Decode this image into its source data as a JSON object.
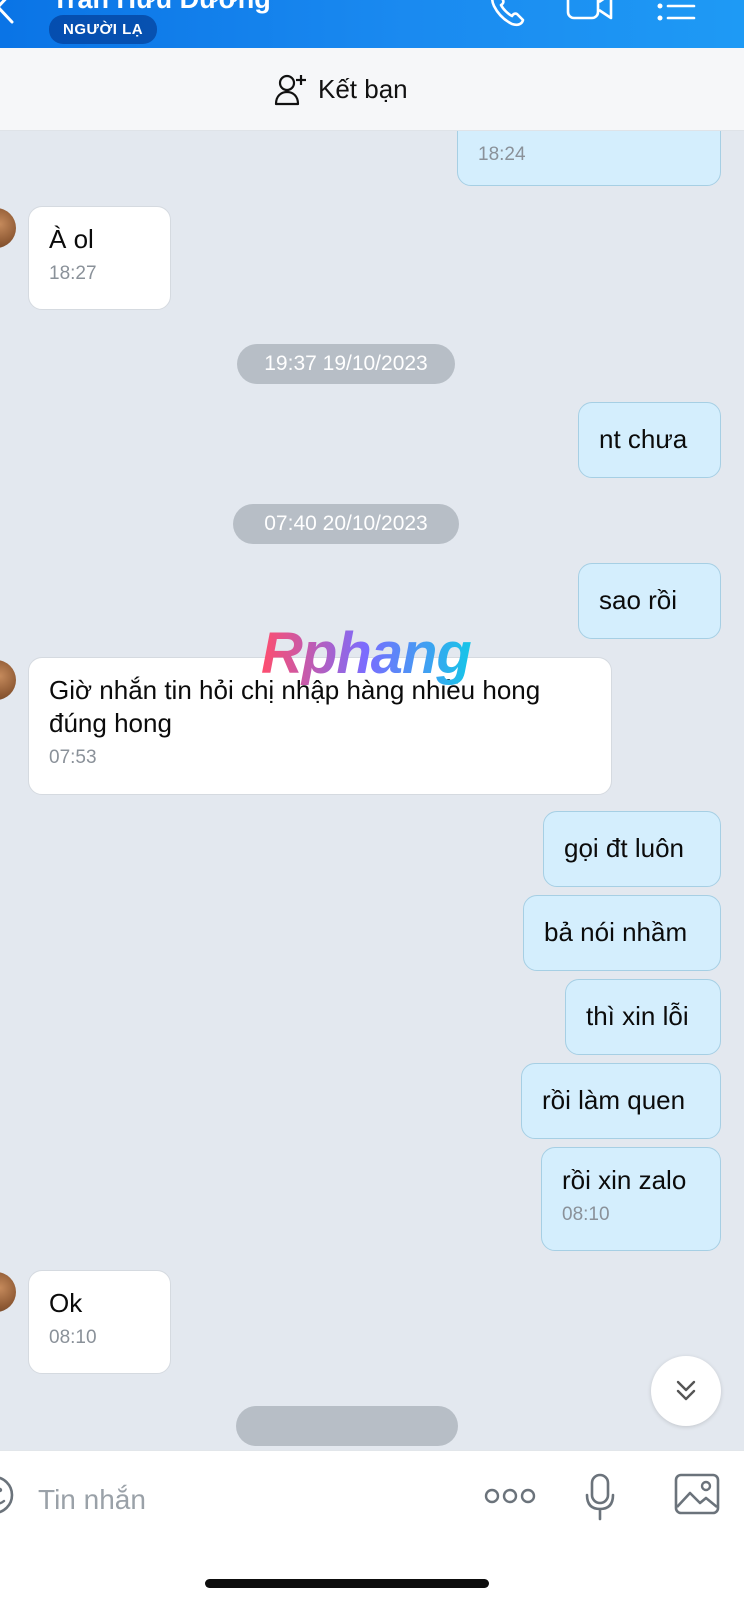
{
  "header": {
    "contact_name": "Trần Hữu Dương",
    "badge": "NGƯỜI LẠ"
  },
  "friend_bar": {
    "label": "Kết bạn"
  },
  "messages": [
    {
      "side": "me",
      "time": "18:24"
    },
    {
      "side": "them",
      "text": "À ol",
      "time": "18:27"
    },
    {
      "type": "date",
      "text": "19:37 19/10/2023"
    },
    {
      "side": "me",
      "text": "nt chưa"
    },
    {
      "type": "date",
      "text": "07:40 20/10/2023"
    },
    {
      "side": "me",
      "text": "sao rồi"
    },
    {
      "side": "them",
      "text": "Giờ nhắn tin hỏi chị nhập hàng nhiều hong đúng hong",
      "time": "07:53"
    },
    {
      "side": "me",
      "text": "gọi đt luôn"
    },
    {
      "side": "me",
      "text": "bả nói nhầm"
    },
    {
      "side": "me",
      "text": "thì xin lỗi"
    },
    {
      "side": "me",
      "text": "rồi làm quen"
    },
    {
      "side": "me",
      "text": "rồi xin zalo",
      "time": "08:10"
    },
    {
      "side": "them",
      "text": "Ok",
      "time": "08:10"
    }
  ],
  "watermark": "Rphang",
  "input": {
    "placeholder": "Tin nhắn"
  },
  "icons": {
    "back": "chevron-left-icon",
    "call": "phone-icon",
    "video": "video-camera-icon",
    "menu": "list-menu-icon",
    "add_friend": "user-plus-icon",
    "scroll_down": "double-chevron-down-icon",
    "sticker": "sticker-icon",
    "more": "more-dots-icon",
    "mic": "microphone-icon",
    "image": "image-icon"
  },
  "colors": {
    "header_blue": "#1a8af0",
    "my_bubble": "#d4eefd",
    "their_bubble": "#ffffff",
    "chat_bg": "#e3e8ef"
  }
}
